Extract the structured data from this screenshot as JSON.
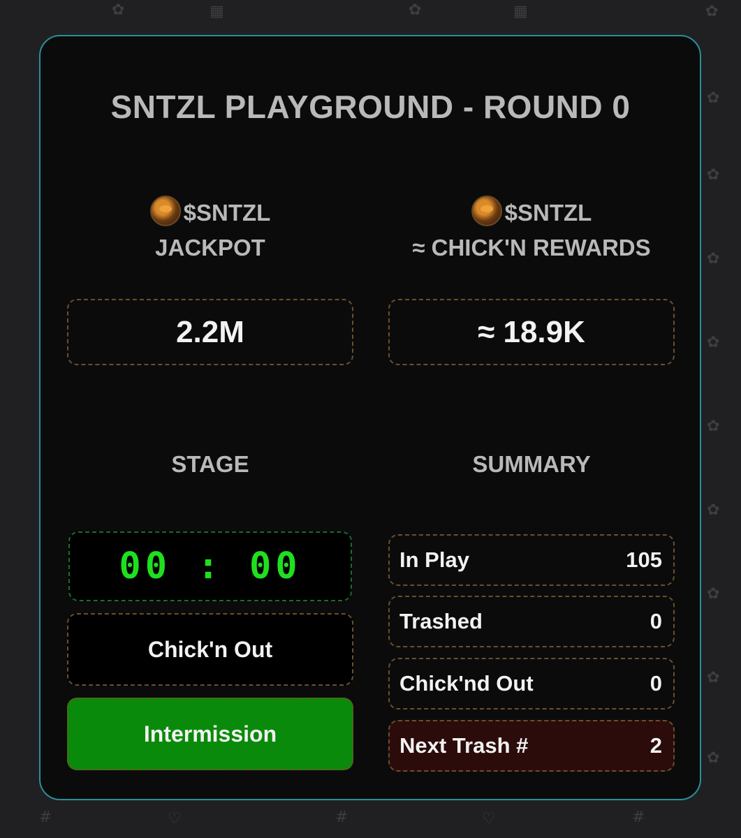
{
  "title": "SNTZL PLAYGROUND - ROUND 0",
  "jackpot": {
    "token": "$SNTZL",
    "label": "JACKPOT",
    "value": "2.2M",
    "coin_icon": "sntzl-coin-icon"
  },
  "rewards": {
    "token": "$SNTZL",
    "label": "≈ CHICK'N REWARDS",
    "value": "≈ 18.9K",
    "coin_icon": "sntzl-coin-icon"
  },
  "stage": {
    "heading": "STAGE",
    "timer": "00 : 00",
    "chickout_label": "Chick'n Out",
    "status_label": "Intermission"
  },
  "summary": {
    "heading": "SUMMARY",
    "rows": [
      {
        "label": "In Play",
        "value": "105"
      },
      {
        "label": "Trashed",
        "value": "0"
      },
      {
        "label": "Chick'nd Out",
        "value": "0"
      },
      {
        "label": "Next Trash #",
        "value": "2"
      }
    ]
  },
  "colors": {
    "accent_border": "#2a8f9a",
    "timer_green": "#1fe01f",
    "intermission_green": "#0a8a0a",
    "next_trash_bg": "#2b0c0b"
  }
}
